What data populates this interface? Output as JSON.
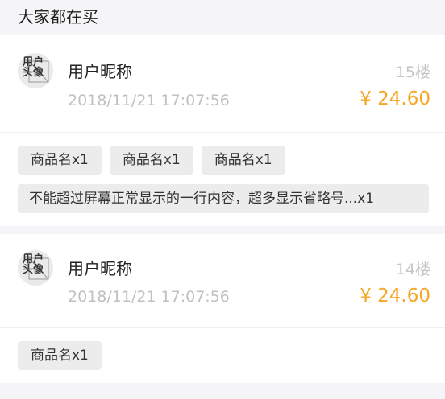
{
  "section": {
    "title": "大家都在买"
  },
  "orders": [
    {
      "avatar_text": "用户头像",
      "nickname": "用户昵称",
      "time": "2018/11/21 17:07:56",
      "floor": "15楼",
      "price": "¥ 24.60",
      "items": [
        "商品名x1",
        "商品名x1",
        "商品名x1",
        "不能超过屏幕正常显示的一行内容，超多显示省略号...x1"
      ]
    },
    {
      "avatar_text": "用户头像",
      "nickname": "用户昵称",
      "time": "2018/11/21 17:07:56",
      "floor": "14楼",
      "price": "¥ 24.60",
      "items": [
        "商品名x1"
      ]
    }
  ],
  "colors": {
    "price": "#f5a623",
    "muted": "#c0c0c0",
    "tag_bg": "#ececec",
    "page_bg": "#f5f5f7"
  }
}
